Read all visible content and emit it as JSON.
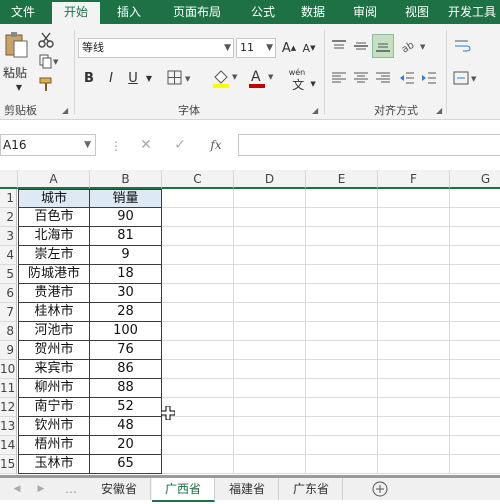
{
  "ribbon_tabs": [
    {
      "label": "文件"
    },
    {
      "label": "开始"
    },
    {
      "label": "插入"
    },
    {
      "label": "页面布局"
    },
    {
      "label": "公式"
    },
    {
      "label": "数据"
    },
    {
      "label": "审阅"
    },
    {
      "label": "视图"
    },
    {
      "label": "开发工具"
    }
  ],
  "clipboard": {
    "paste_label": "粘贴",
    "group_label": "剪贴板"
  },
  "font": {
    "name": "等线",
    "size": "11",
    "bold": "B",
    "italic": "I",
    "underline": "U",
    "group_label": "字体",
    "pinyin": "wén",
    "font_color": "#c00000",
    "fill_color": "#ffff00"
  },
  "alignment": {
    "group_label": "对齐方式"
  },
  "formula_bar": {
    "name_box": "A16",
    "fx": "fx",
    "formula": ""
  },
  "columns": [
    "A",
    "B",
    "C",
    "D",
    "E",
    "F",
    "G"
  ],
  "rows": [
    "1",
    "2",
    "3",
    "4",
    "5",
    "6",
    "7",
    "8",
    "9",
    "10",
    "11",
    "12",
    "13",
    "14",
    "15"
  ],
  "table": {
    "headers": [
      "城市",
      "销量"
    ],
    "data": [
      [
        "百色市",
        "90"
      ],
      [
        "北海市",
        "81"
      ],
      [
        "崇左市",
        "9"
      ],
      [
        "防城港市",
        "18"
      ],
      [
        "贵港市",
        "30"
      ],
      [
        "桂林市",
        "28"
      ],
      [
        "河池市",
        "100"
      ],
      [
        "贺州市",
        "76"
      ],
      [
        "来宾市",
        "86"
      ],
      [
        "柳州市",
        "88"
      ],
      [
        "南宁市",
        "52"
      ],
      [
        "钦州市",
        "48"
      ],
      [
        "梧州市",
        "20"
      ],
      [
        "玉林市",
        "65"
      ]
    ]
  },
  "sheet_tabs": [
    "安徽省",
    "广西省",
    "福建省",
    "广东省"
  ],
  "active_sheet": "广西省",
  "colors": {
    "accent": "#1e7145",
    "header_fill": "#dde9f5"
  }
}
